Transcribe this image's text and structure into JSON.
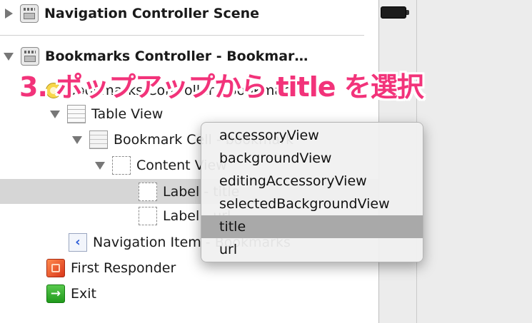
{
  "outline": {
    "rows": [
      {
        "label": "Navigation Controller Scene"
      },
      {
        "label": "Bookmarks Controller - Bookmar…"
      },
      {
        "label": "Bookmarks Controller - Bookmarks"
      },
      {
        "label": "Table View"
      },
      {
        "label": "Bookmark Cell - bookmark"
      },
      {
        "label": "Content View"
      },
      {
        "label": "Label - title"
      },
      {
        "label": "Label - url"
      },
      {
        "label": "Navigation Item - Bookmarks"
      },
      {
        "label": "First Responder"
      },
      {
        "label": "Exit"
      }
    ]
  },
  "popup": {
    "items": [
      {
        "label": "accessoryView"
      },
      {
        "label": "backgroundView"
      },
      {
        "label": "editingAccessoryView"
      },
      {
        "label": "selectedBackgroundView"
      },
      {
        "label": "title"
      },
      {
        "label": "url"
      }
    ],
    "highlighted": "title"
  },
  "annotation": {
    "text": "3. ポップアップから title を選択",
    "color": "#f2337a"
  },
  "icons": {
    "scene": "storyboard-scene-icon",
    "controller": "view-controller-icon",
    "table": "table-view-icon",
    "cell": "table-cell-icon",
    "content": "content-view-icon",
    "label": "label-icon",
    "nav_item": "back-chevron-icon",
    "responder": "first-responder-cube-icon",
    "exit": "exit-icon",
    "battery": "battery-icon"
  }
}
